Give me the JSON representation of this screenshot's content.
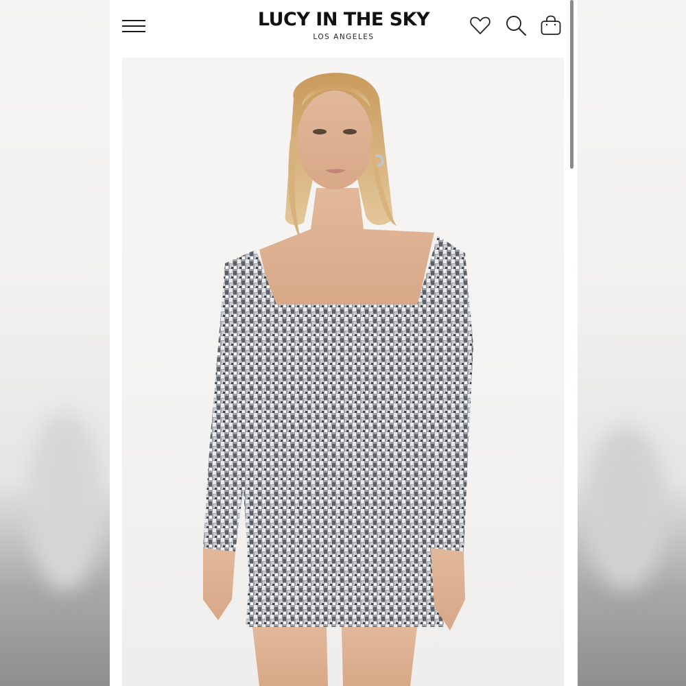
{
  "header": {
    "brand_name": "LUCY IN THE SKY",
    "brand_location": "LOS ANGELES"
  },
  "icons": {
    "menu": "hamburger-menu-icon",
    "wishlist": "heart-icon",
    "search": "search-icon",
    "cart": "shopping-bag-icon"
  },
  "colors": {
    "text": "#111111",
    "background": "#ffffff",
    "dress": "#b9bcc0"
  }
}
